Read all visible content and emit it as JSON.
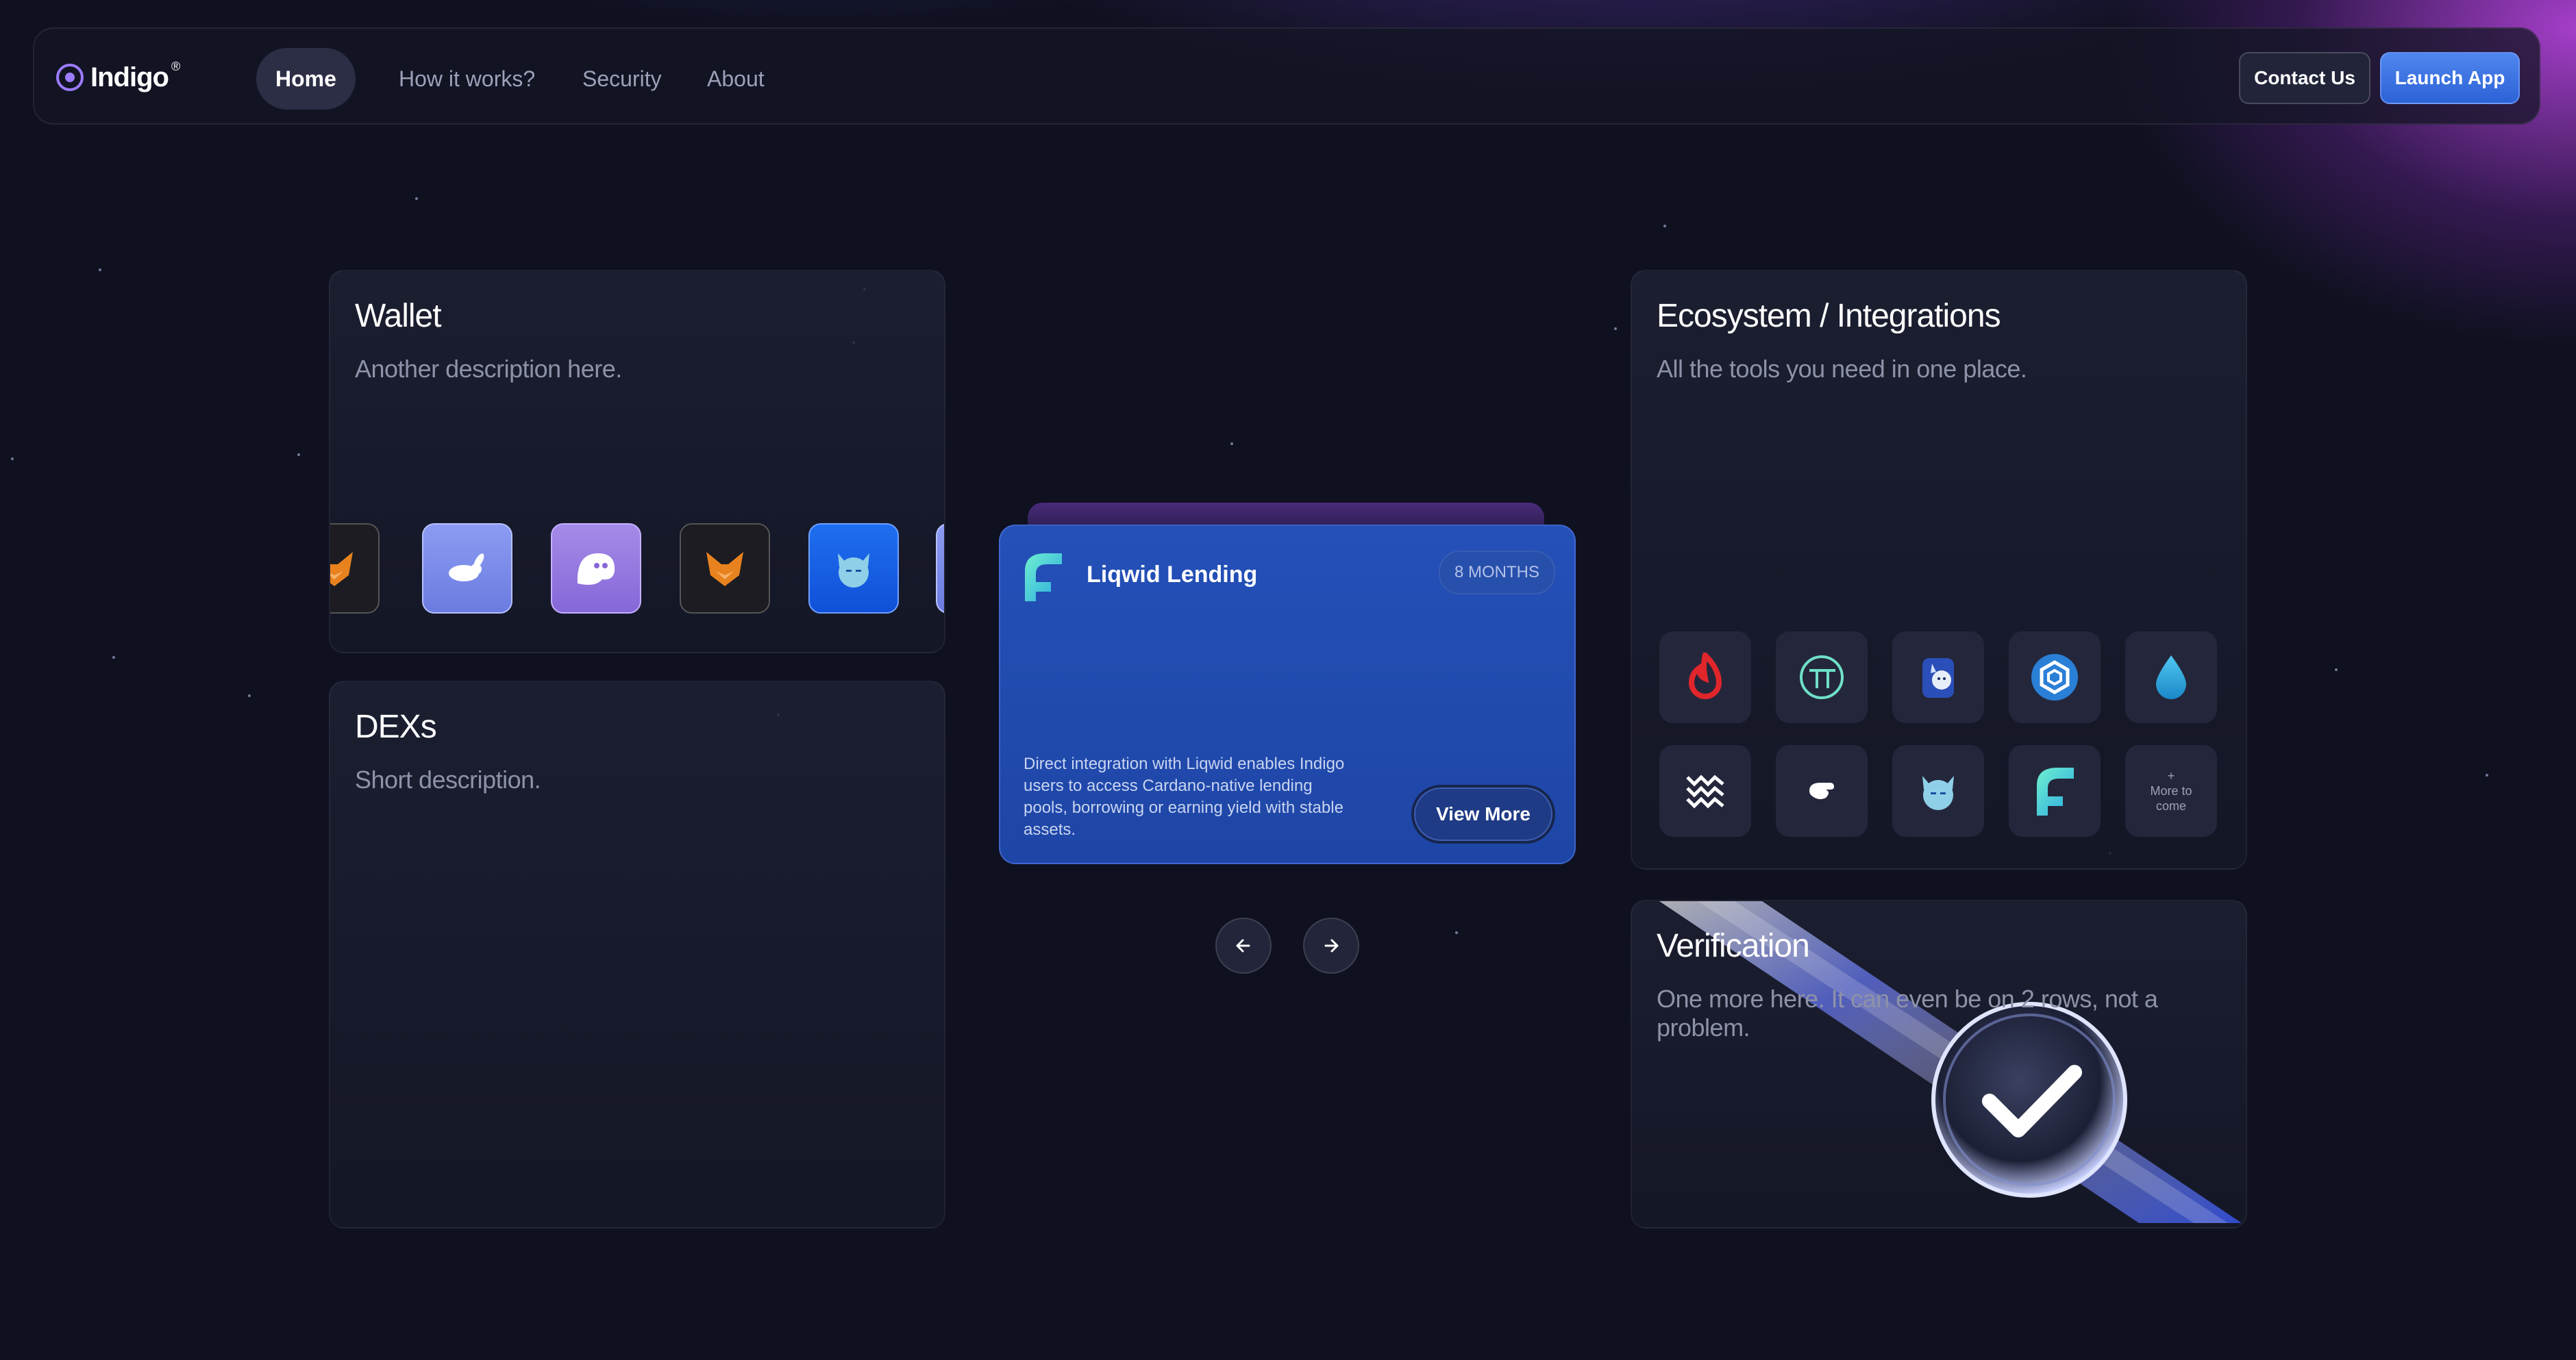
{
  "header": {
    "logo_text": "Indigo",
    "logo_sup": "®",
    "nav": [
      {
        "label": "Home",
        "active": true
      },
      {
        "label": "How it works?"
      },
      {
        "label": "Security"
      },
      {
        "label": "About"
      }
    ],
    "contact_label": "Contact Us",
    "launch_label": "Launch App"
  },
  "wallet": {
    "title": "Wallet",
    "description": "Another description here.",
    "icons": [
      "fox-icon",
      "rabbit-icon",
      "ghost-icon",
      "fox-icon",
      "cat-icon"
    ]
  },
  "dexs": {
    "title": "DEXs",
    "description": "Short description."
  },
  "carousel": {
    "card_title": "Liqwid Lending",
    "badge": "8 MONTHS",
    "description": "Direct integration with Liqwid enables Indigo users to access Cardano-native lending pools, borrowing or earning yield with stable assets.",
    "button_label": "View More"
  },
  "ecosystem": {
    "title": "Ecosystem / Integrations",
    "description": "All the tools you need in one place.",
    "icons": [
      "flame-icon",
      "tt-icon",
      "dog-icon",
      "hexagon-icon",
      "drop-icon",
      "waves-icon",
      "hand-icon",
      "cat-icon",
      "liqwid-icon",
      "more-icon"
    ],
    "more_label_plus": "+",
    "more_label": "More to come"
  },
  "verification": {
    "title": "Verification",
    "description": "One more here. It can even be on 2 rows, not a problem."
  },
  "colors": {
    "background": "#0f1120",
    "accent": "#9b7cff",
    "launch": "#3a74e3",
    "card_blue": "#2450b8"
  }
}
